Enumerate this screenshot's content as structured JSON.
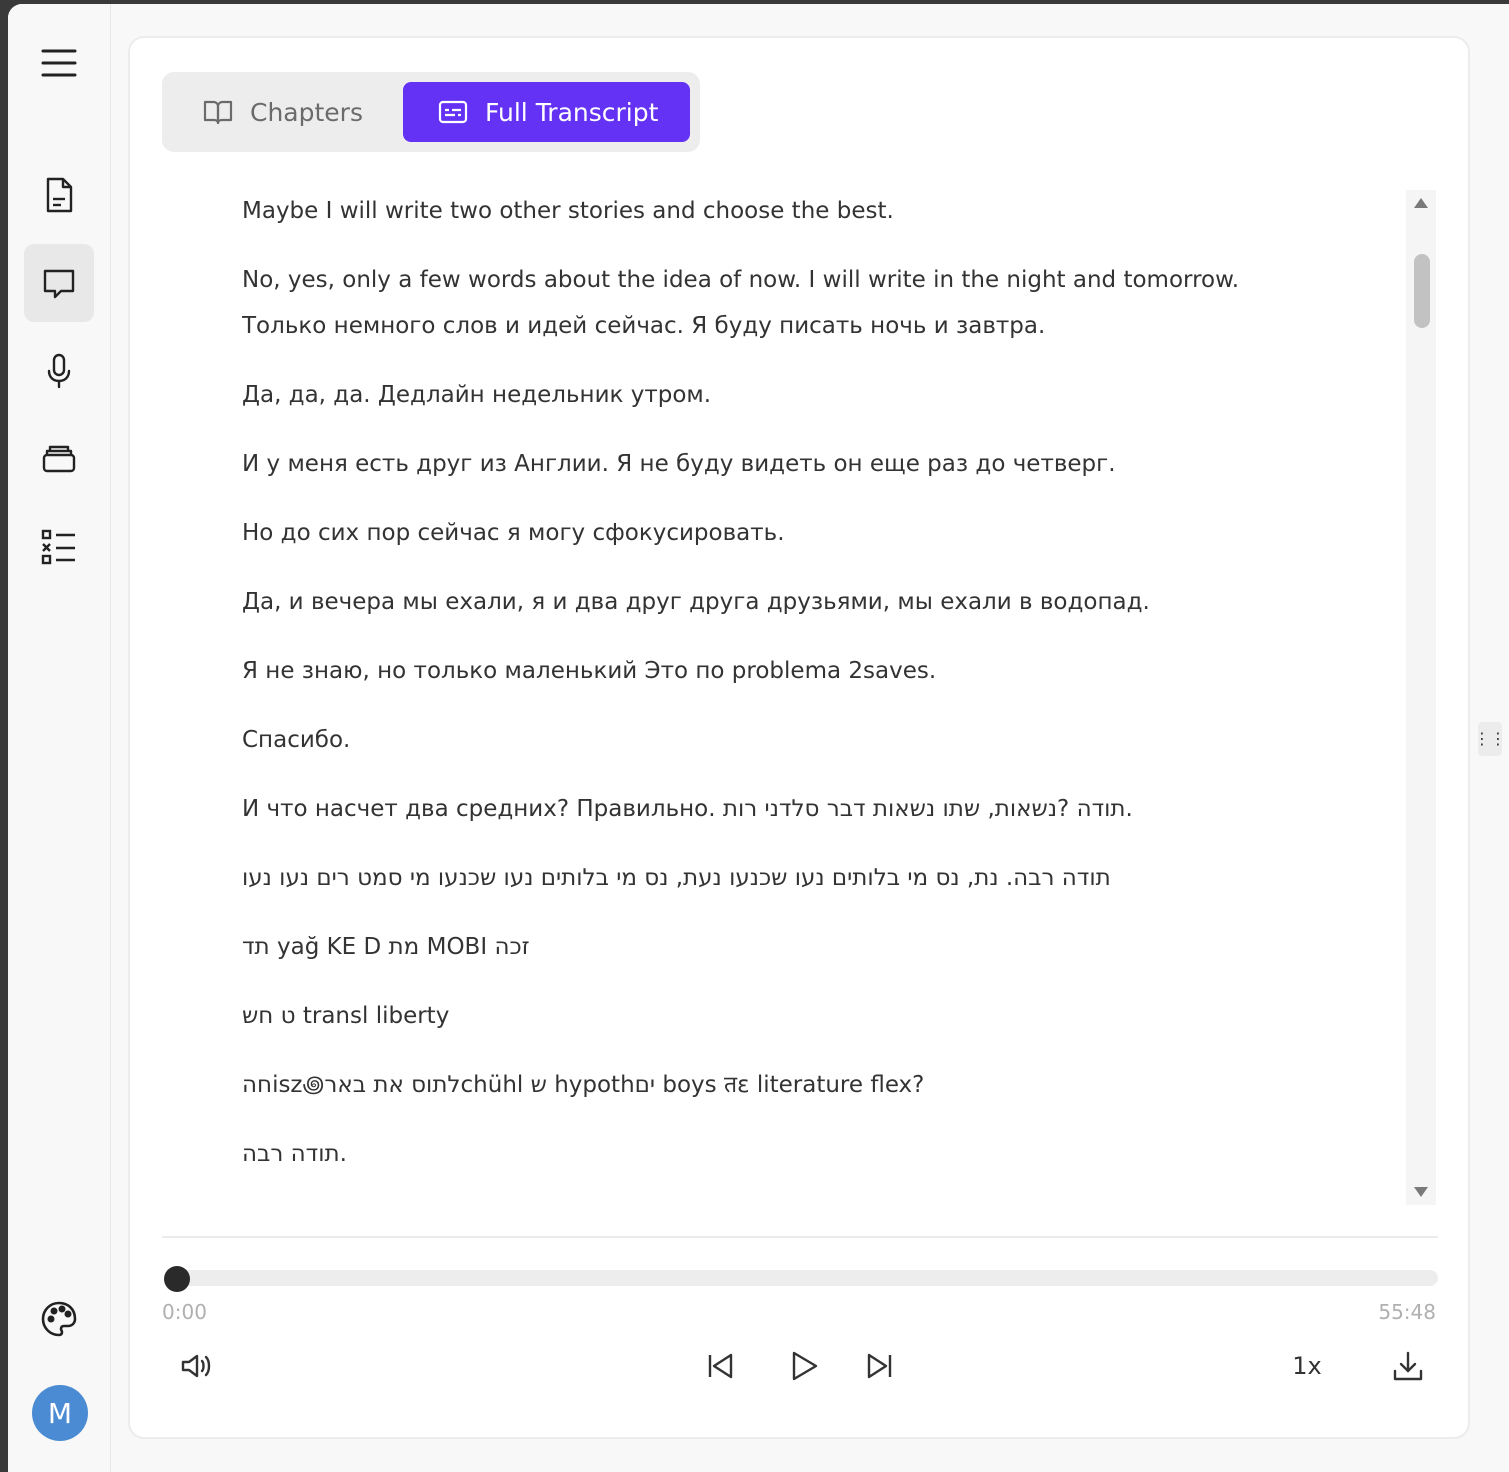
{
  "sidebar": {
    "menu_icon": "hamburger-icon",
    "items": [
      {
        "icon": "document-icon",
        "active": false
      },
      {
        "icon": "chat-bubble-icon",
        "active": true
      },
      {
        "icon": "microphone-icon",
        "active": false
      },
      {
        "icon": "stack-icon",
        "active": false
      },
      {
        "icon": "checklist-icon",
        "active": false
      }
    ],
    "palette_icon": "palette-icon",
    "avatar_initial": "M"
  },
  "tabs": {
    "chapters_label": "Chapters",
    "full_transcript_label": "Full Transcript",
    "active": "full_transcript"
  },
  "transcript": {
    "paragraphs": [
      [
        "Maybe I will write two other stories and choose the best."
      ],
      [
        "No, yes, only a few words about the idea of now. I will write in the night and tomorrow.",
        "Только немного слов и идей сейчас. Я буду писать ночь и завтра."
      ],
      [
        "Да, да, да. Дедлайн недельник утром."
      ],
      [
        "И у меня есть друг из Англии. Я не буду видеть он еще раз до четверг."
      ],
      [
        "Но до сих пор сейчас я могу сфокусировать."
      ],
      [
        "Да, и вечера мы ехали, я и два друг друга друзьями, мы ехали в водопад."
      ],
      [
        "Я не знаю, но только маленький Это по problema 2saves."
      ],
      [
        "Спасибо."
      ],
      [
        "И что насчет два средних? Правильно. תודה ?נשאות, שתו נשאות דבר סלדני רות."
      ],
      [
        "תודה רבה. נת, נס מי בלותים נעו שכנעו נעת, נס מי בלותים נעו שכנעו מי סמט רים נעו נעו"
      ],
      [
        "תד yağ KE D מת MOBI זכה"
      ],
      [
        "ט חש transl liberty"
      ],
      [
        "חהisz꩜לתוס את בארchühl ש hypothים boys तε literature flex?"
      ],
      [
        "תודה רבה."
      ]
    ]
  },
  "player": {
    "progress": 0,
    "current_time": "0:00",
    "total_time": "55:48",
    "speed_label": "1x"
  },
  "colors": {
    "accent": "#6432f5",
    "avatar": "#4a8bd4"
  }
}
